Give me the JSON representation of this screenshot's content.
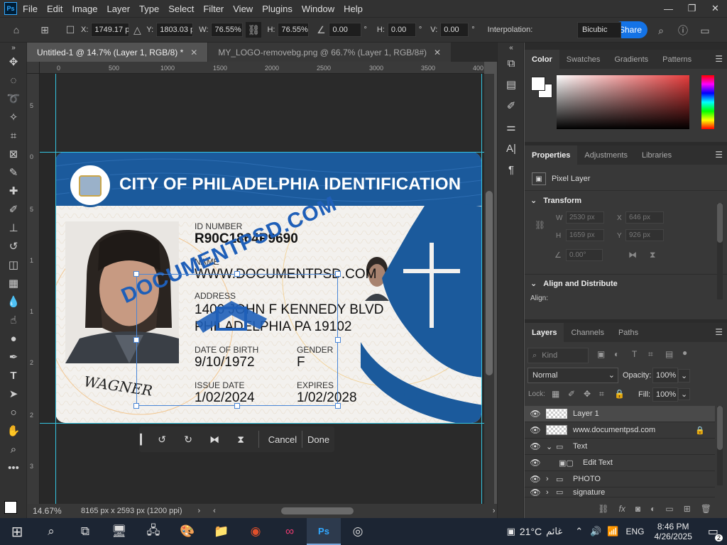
{
  "app": {
    "logo": "Ps"
  },
  "menu": [
    "File",
    "Edit",
    "Image",
    "Layer",
    "Type",
    "Select",
    "Filter",
    "View",
    "Plugins",
    "Window",
    "Help"
  ],
  "window_controls": {
    "minimize": "—",
    "restore": "❐",
    "close": "✕"
  },
  "options": {
    "x_label": "X:",
    "x_value": "1749.17 p",
    "y_label": "Y:",
    "y_value": "1803.03 p",
    "w_label": "W:",
    "w_value": "76.55%",
    "h_label": "H:",
    "h_value": "76.55%",
    "angle_value": "0.00",
    "angle_unit": "°",
    "hskew_label": "H:",
    "hskew_value": "0.00",
    "hskew_unit": "°",
    "vskew_label": "V:",
    "vskew_value": "0.00",
    "vskew_unit": "°",
    "interp_label": "Interpolation:",
    "interp_value": "Bicubic",
    "share": "Share"
  },
  "tabs": [
    {
      "label": "Untitled-1 @ 14.7% (Layer 1, RGB/8) *",
      "active": true
    },
    {
      "label": "MY_LOGO-removebg.png @ 66.7% (Layer 1, RGB/8#)",
      "active": false
    }
  ],
  "ruler_top": [
    "0",
    "500",
    "1000",
    "1500",
    "2000",
    "2500",
    "3000",
    "3500",
    "400"
  ],
  "ruler_left": [
    "5",
    "0",
    "5",
    "1",
    "1",
    "2",
    "2",
    "3",
    "3",
    "4",
    "4"
  ],
  "card": {
    "title": "CITY OF PHILADELPHIA IDENTIFICATION",
    "id_label": "ID NUMBER",
    "id_value": "R90C1864P9690",
    "name_label": "NAME",
    "name_value": "WWW.DOCUMENTPSD.COM",
    "address_label": "ADDRESS",
    "address_line1": "1400 JOHN F KENNEDY BLVD",
    "address_line2": "PHILADELPHIA PA 19102",
    "dob_label": "DATE OF BIRTH",
    "dob_value": "9/10/1972",
    "gender_label": "GENDER",
    "gender_value": "F",
    "issue_label": "ISSUE DATE",
    "issue_value": "1/02/2024",
    "expires_label": "EXPIRES",
    "expires_value": "1/02/2028",
    "signature": "WAGNER",
    "watermark": "DOCUMENTPSD.COM"
  },
  "transform_bar": {
    "cancel": "Cancel",
    "done": "Done"
  },
  "status": {
    "zoom": "14.67%",
    "doc_info": "8165 px x 2593 px (1200 ppi)"
  },
  "color_panel": {
    "tabs": [
      "Color",
      "Swatches",
      "Gradients",
      "Patterns"
    ]
  },
  "properties_panel": {
    "tabs": [
      "Properties",
      "Adjustments",
      "Libraries"
    ],
    "layer_kind": "Pixel Layer",
    "transform_title": "Transform",
    "w_label": "W",
    "w_value": "2530 px",
    "x_label": "X",
    "x_value": "646 px",
    "h_label": "H",
    "h_value": "1659 px",
    "y_label": "Y",
    "y_value": "926 px",
    "angle_value": "0.00°",
    "align_title": "Align and Distribute",
    "align_label": "Align:"
  },
  "layers_panel": {
    "tabs": [
      "Layers",
      "Channels",
      "Paths"
    ],
    "kind_placeholder": "Kind",
    "blend_mode": "Normal",
    "opacity_label": "Opacity:",
    "opacity_value": "100%",
    "lock_label": "Lock:",
    "fill_label": "Fill:",
    "fill_value": "100%",
    "layers": [
      {
        "name": "Layer 1",
        "type": "pixel",
        "selected": true,
        "indent": 0
      },
      {
        "name": "www.documentpsd.com",
        "type": "pixel",
        "selected": false,
        "indent": 0,
        "locked": true
      },
      {
        "name": "Text",
        "type": "group",
        "selected": false,
        "indent": 0,
        "expanded": true
      },
      {
        "name": "Edit Text",
        "type": "smart",
        "selected": false,
        "indent": 1
      },
      {
        "name": "PHOTO",
        "type": "group",
        "selected": false,
        "indent": 0,
        "expanded": false
      },
      {
        "name": "signature",
        "type": "group",
        "selected": false,
        "indent": 0,
        "expanded": false
      }
    ]
  },
  "taskbar": {
    "temperature": "21°C",
    "weather_text": "غائم",
    "language": "ENG",
    "time": "8:46 PM",
    "date": "4/26/2025",
    "notification_count": "2"
  },
  "colors": {
    "accent": "#1473e6",
    "card_blue": "#1b5a9c",
    "guide": "#35c4e0"
  }
}
